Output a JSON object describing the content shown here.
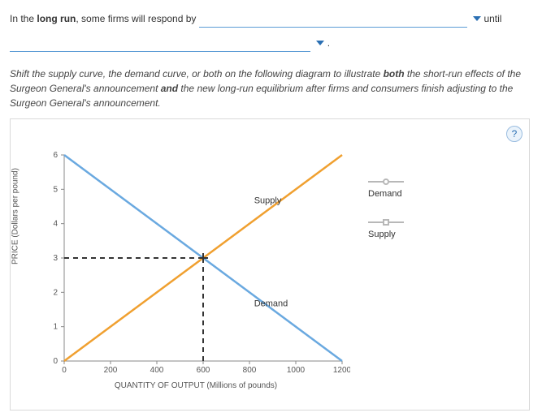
{
  "sentence": {
    "prefix": "In the ",
    "bold1": "long run",
    "mid1": ", some firms will respond by ",
    "after_blank1": " until",
    "period": " ."
  },
  "instructions": {
    "part1": "Shift the supply curve, the demand curve, or both on the following diagram to illustrate ",
    "bold1": "both",
    "part2": " the short-run effects of the Surgeon General's announcement ",
    "bold2": "and",
    "part3": " the new long-run equilibrium after firms and consumers finish adjusting to the Surgeon General's announcement."
  },
  "help_label": "?",
  "legend": {
    "demand": "Demand",
    "supply": "Supply"
  },
  "chart_data": {
    "type": "line",
    "title": "",
    "xlabel": "QUANTITY OF OUTPUT (Millions of pounds)",
    "ylabel": "PRICE (Dollars per pound)",
    "xlim": [
      0,
      1200
    ],
    "ylim": [
      0,
      6
    ],
    "xticks": [
      0,
      200,
      400,
      600,
      800,
      1000,
      1200
    ],
    "yticks": [
      0,
      1,
      2,
      3,
      4,
      5,
      6
    ],
    "series": [
      {
        "name": "Demand",
        "color": "#6aa9e0",
        "points": [
          [
            0,
            6
          ],
          [
            1200,
            0
          ]
        ]
      },
      {
        "name": "Supply",
        "color": "#f0a030",
        "points": [
          [
            0,
            0
          ],
          [
            1200,
            6
          ]
        ]
      }
    ],
    "equilibrium": {
      "x": 600,
      "y": 3
    },
    "curve_labels": {
      "supply": {
        "text": "Supply",
        "x": 820,
        "y": 4.6
      },
      "demand": {
        "text": "Demand",
        "x": 820,
        "y": 1.6
      }
    }
  }
}
